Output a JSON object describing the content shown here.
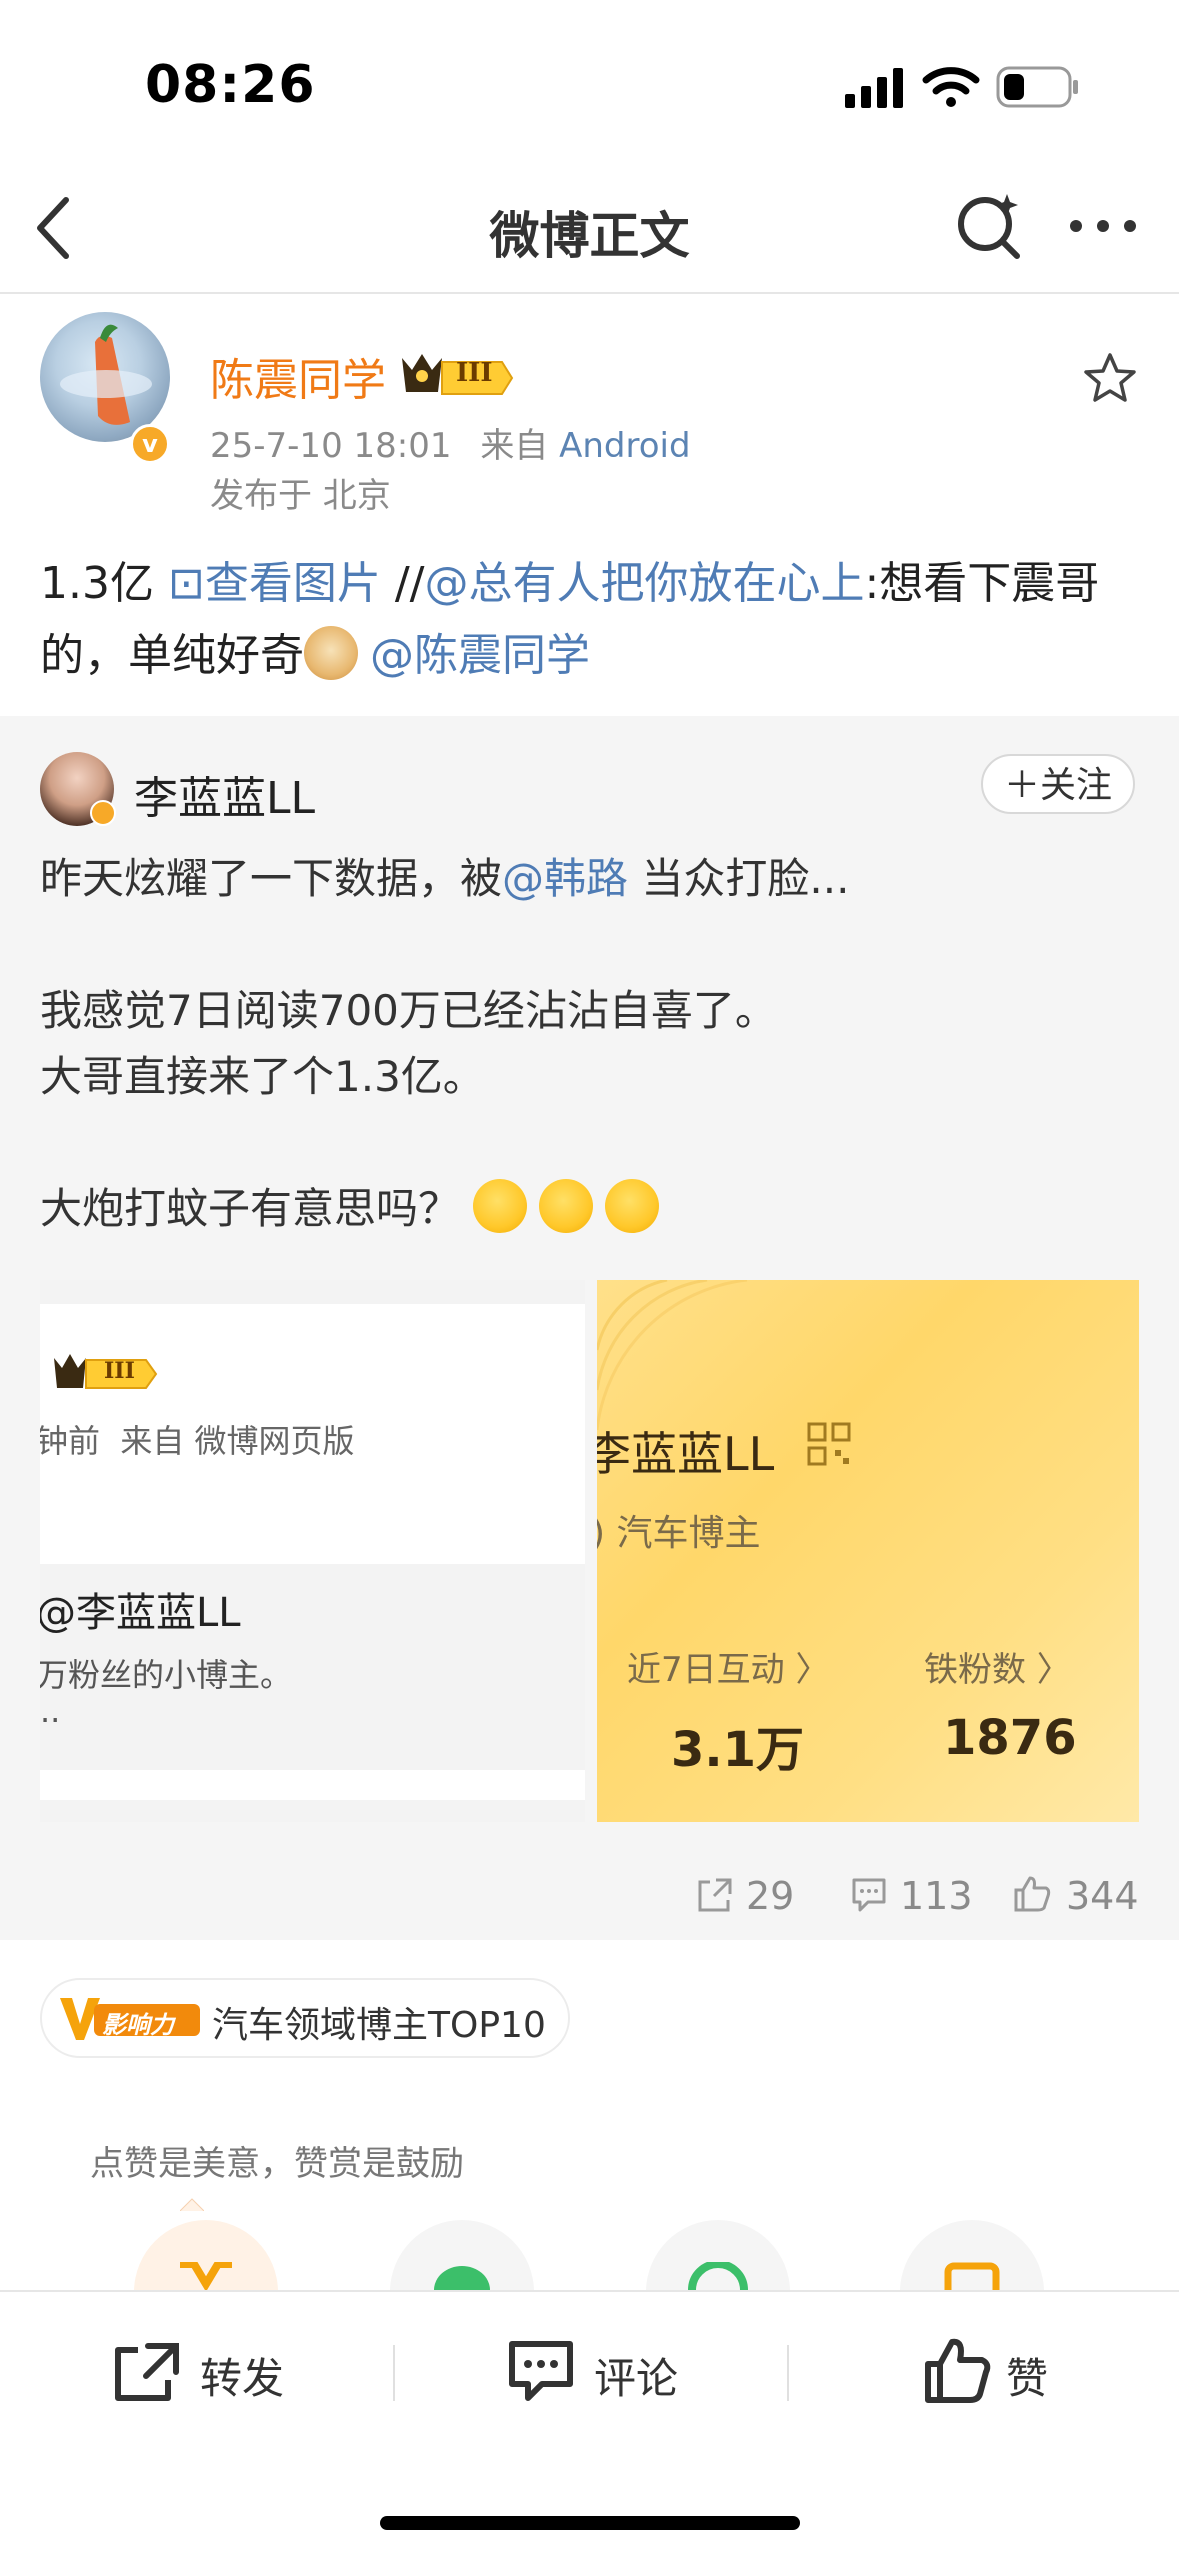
{
  "status_bar": {
    "time": "08:26"
  },
  "nav": {
    "title": "微博正文"
  },
  "post": {
    "author": "陈震同学",
    "level_badge": "III",
    "time": "25-7-10 18:01",
    "source_prefix": "来自",
    "source": "Android",
    "location": "发布于 北京",
    "text": {
      "part1": "1.3亿 ",
      "view_image": "⊡查看图片",
      "sep": " //",
      "mention1": "@总有人把你放在心上",
      "part2": ":想看下震哥的，单纯好奇",
      "mention2": "@陈震同学"
    }
  },
  "repost": {
    "author": "李蓝蓝LL",
    "follow_label": "＋关注",
    "line1_pre": "昨天炫耀了一下数据，被",
    "line1_mention": "@韩路",
    "line1_post": " 当众打脸...",
    "line2": "我感觉7日阅读700万已经沾沾自喜了。",
    "line3": "大哥直接来了个1.3亿。",
    "line4": "大炮打蚊子有意思吗？",
    "images": {
      "left": {
        "level_badge": "III",
        "time_source": "钟前  来自 微博网页版",
        "handle": "@李蓝蓝LL",
        "bio": "万粉丝的小博主。",
        "ellipsis": ".."
      },
      "right": {
        "name": "李蓝蓝LL",
        "category": "汽车博主",
        "stat1_label": "近7日互动 〉",
        "stat1_value": "3.1万",
        "stat2_label": "铁粉数 〉",
        "stat2_value": "1876"
      }
    },
    "stats": {
      "reposts": "29",
      "comments": "113",
      "likes": "344"
    }
  },
  "influence": {
    "badge": "影响力",
    "text": "汽车领域博主TOP10"
  },
  "reward": {
    "text": "点赞是美意，赞赏是鼓励"
  },
  "bottom_bar": {
    "repost": "转发",
    "comment": "评论",
    "like": "赞"
  },
  "colors": {
    "accent_orange": "#f07a16",
    "link_blue": "#4f7cb5"
  }
}
